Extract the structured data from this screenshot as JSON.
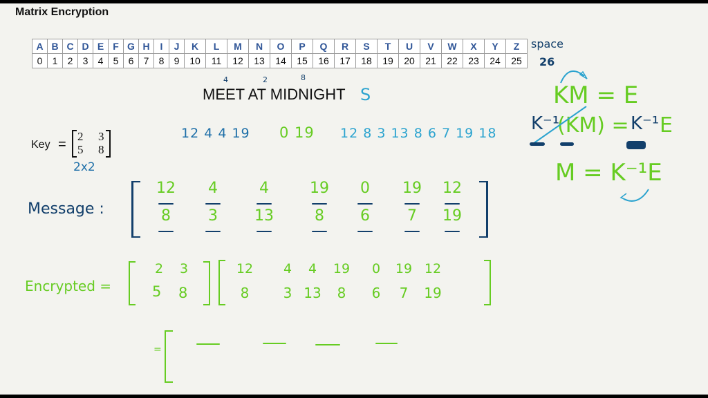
{
  "title": "Matrix Encryption",
  "alphabet": {
    "letters": [
      "A",
      "B",
      "C",
      "D",
      "E",
      "F",
      "G",
      "H",
      "I",
      "J",
      "K",
      "L",
      "M",
      "N",
      "O",
      "P",
      "Q",
      "R",
      "S",
      "T",
      "U",
      "V",
      "W",
      "X",
      "Y",
      "Z"
    ],
    "numbers": [
      "0",
      "1",
      "2",
      "3",
      "4",
      "5",
      "6",
      "7",
      "8",
      "9",
      "10",
      "11",
      "12",
      "13",
      "14",
      "15",
      "16",
      "17",
      "18",
      "19",
      "20",
      "21",
      "22",
      "23",
      "24",
      "25"
    ],
    "space_label": "space",
    "space_value": "26"
  },
  "message": {
    "text": "MEET AT MIDNIGHT",
    "padding_char": "S",
    "annotations": [
      "4",
      "2",
      "8"
    ]
  },
  "key": {
    "label": "Key",
    "equals": "=",
    "matrix": [
      [
        "2",
        "3"
      ],
      [
        "5",
        "8"
      ]
    ],
    "size_note": "2x2"
  },
  "numeric_sequence": {
    "group1": "12 4 4 19",
    "group2": "0 19",
    "group3": "12 8 3 13 8 6 7 19 18"
  },
  "equations": {
    "line1": "KM = E",
    "line2_left": "K⁻¹",
    "line2_mid": "(KM) =",
    "line2_k": "K⁻¹",
    "line2_e": "E",
    "line3": "M = K⁻¹E"
  },
  "message_matrix": {
    "label": "Message :",
    "top": [
      "12",
      "4",
      "4",
      "19",
      "0",
      "19",
      "12"
    ],
    "bottom": [
      "8",
      "3",
      "13",
      "8",
      "6",
      "7",
      "19"
    ]
  },
  "encrypted": {
    "label": "Encrypted =",
    "key_matrix": [
      [
        "2",
        "3"
      ],
      [
        "5",
        "8"
      ]
    ],
    "top": [
      "12",
      "4",
      "4",
      "19",
      "0",
      "19",
      "12"
    ],
    "bottom": [
      "8",
      "3",
      "13",
      "8",
      "6",
      "7",
      "19"
    ],
    "result_prefix": "="
  },
  "colors": {
    "blue_ink": "#1e6fa8",
    "navy_ink": "#123f6b",
    "teal_ink": "#2ba3cf",
    "green_ink": "#66cc22",
    "table_header": "#2f5597"
  }
}
